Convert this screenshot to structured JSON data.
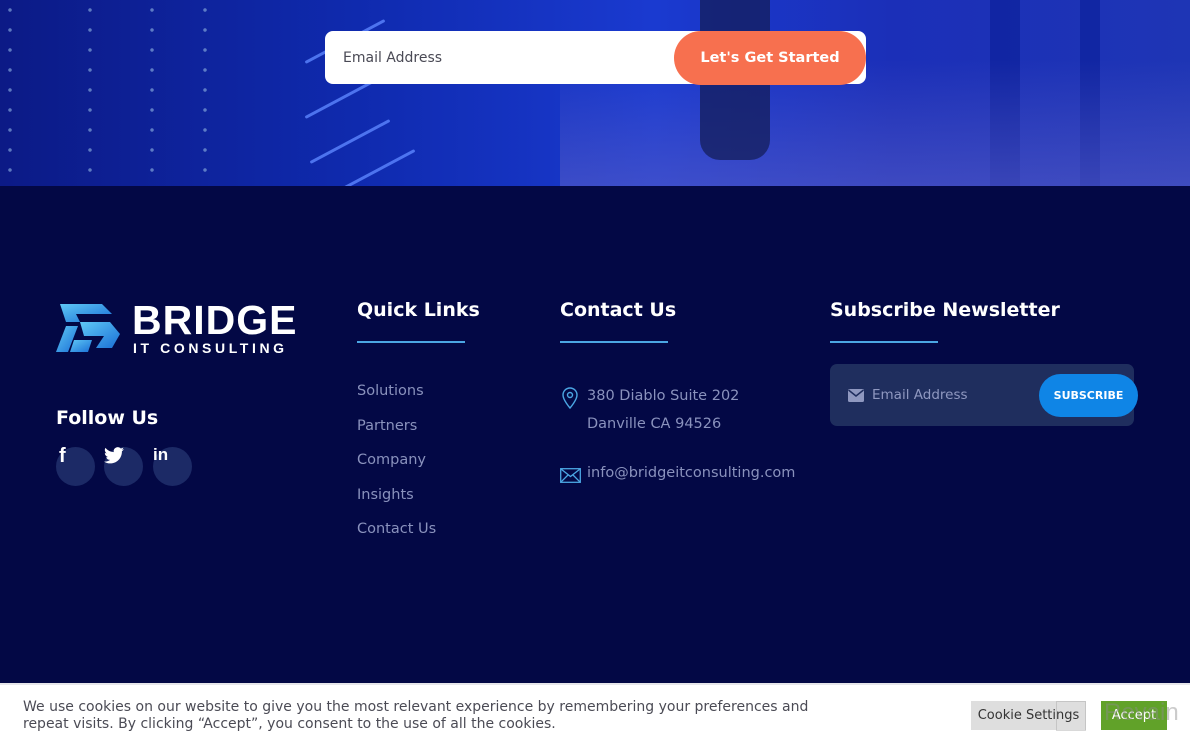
{
  "hero": {
    "email_placeholder": "Email Address",
    "cta_label": "Let's Get Started"
  },
  "brand": {
    "name": "BRIDGE",
    "tagline": "IT CONSULTING",
    "logo_icon": "bridge-b-logo-icon"
  },
  "follow": {
    "title": "Follow Us",
    "social": [
      {
        "name": "facebook",
        "glyph": "f"
      },
      {
        "name": "twitter",
        "glyph": "twitter-bird"
      },
      {
        "name": "linkedin",
        "glyph": "in"
      }
    ]
  },
  "quick_links": {
    "title": "Quick Links",
    "items": [
      "Solutions",
      "Partners",
      "Company",
      "Insights",
      "Contact Us"
    ]
  },
  "contact": {
    "title": "Contact Us",
    "address_line1": "380 Diablo Suite 202",
    "address_line2": "Danville CA 94526",
    "email": "info@bridgeitconsulting.com"
  },
  "newsletter": {
    "title": "Subscribe Newsletter",
    "email_placeholder": "Email Address",
    "button_label": "SUBSCRIBE"
  },
  "cookie": {
    "text_line1": "We use cookies on our website to give you the most relevant experience by remembering your preferences and",
    "text_line2": "repeat visits. By clicking “Accept”, you consent to the use of all the cookies.",
    "settings_label": "Cookie Settings",
    "accept_label": "Accept",
    "watermark": "Revain"
  },
  "colors": {
    "footer_bg": "#030845",
    "accent_orange": "#f7704f",
    "accent_blue": "#0f85e6",
    "underline": "#4ba6e3",
    "accept_green": "#61a229"
  }
}
